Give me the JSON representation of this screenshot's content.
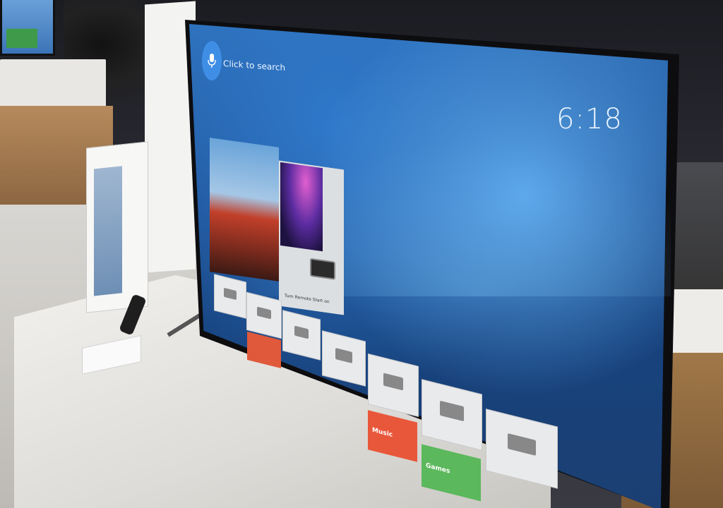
{
  "search": {
    "label": "Click to search",
    "icon": "microphone-icon"
  },
  "clock": {
    "time": "6:18"
  },
  "recommendations": [
    {
      "caption": ""
    },
    {
      "caption": "Turn Remote Start on"
    }
  ],
  "inputs": [
    {
      "label": ""
    },
    {
      "label": ""
    },
    {
      "label": ""
    },
    {
      "label": ""
    },
    {
      "label": ""
    },
    {
      "label": ""
    },
    {
      "label": ""
    }
  ],
  "apps": [
    {
      "label": "",
      "color": "#e0593a"
    },
    {
      "label": "Music",
      "color": "#e9573b"
    },
    {
      "label": "Games",
      "color": "#5cb85c"
    }
  ],
  "colors": {
    "screen_blue": "#1e4f92",
    "accent": "#3f8ee6"
  }
}
